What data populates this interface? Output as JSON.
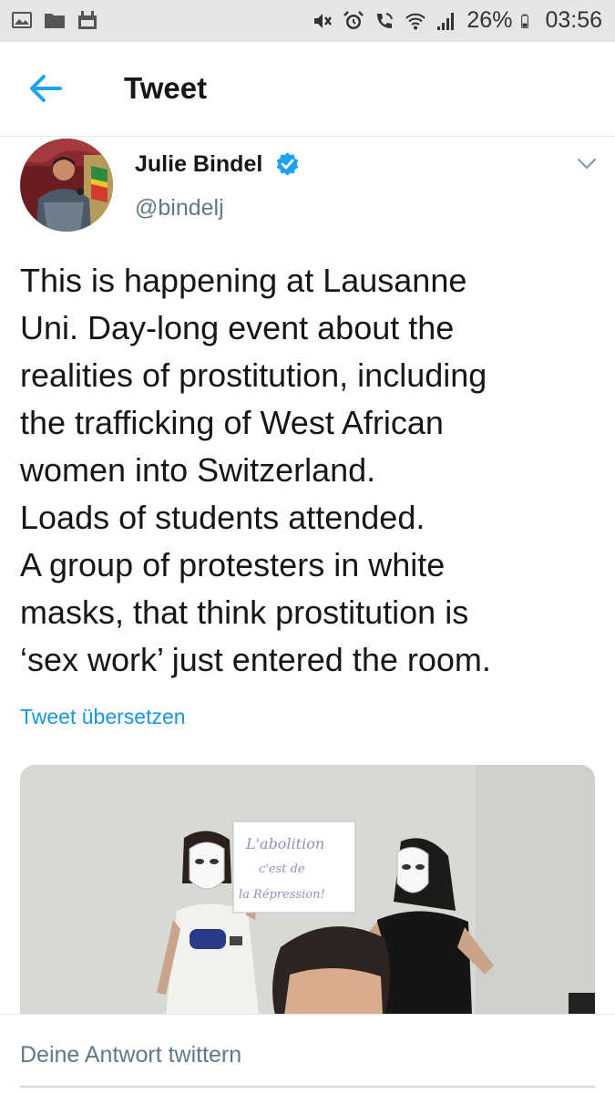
{
  "status_bar": {
    "battery": "26%",
    "time": "03:56",
    "left_icons": [
      "image-icon",
      "folder-icon",
      "calendar-icon"
    ],
    "right_icons": [
      "mute-icon",
      "alarm-icon",
      "wifi-call-icon",
      "wifi-icon",
      "signal-icon",
      "battery-icon"
    ]
  },
  "header": {
    "title": "Tweet",
    "back_icon": "back-arrow-icon"
  },
  "author": {
    "name": "Julie Bindel",
    "handle": "@bindelj",
    "verified": true,
    "menu_icon": "chevron-down-icon"
  },
  "tweet": {
    "lines": [
      "This is happening at Lausanne",
      "Uni. Day-long event about the",
      "realities of prostitution, including",
      "the trafficking of West African",
      "women into Switzerland.",
      "Loads of students attended.",
      "A group of protesters in white",
      "masks, that think prostitution is",
      "‘sex work’ just entered the room."
    ],
    "translate_label": "Tweet übersetzen"
  },
  "media": {
    "sign_lines": [
      "L'abolition",
      "c'est de",
      "la Répression!"
    ]
  },
  "reply": {
    "placeholder": "Deine Antwort twittern"
  },
  "colors": {
    "accent": "#1da1f2",
    "link": "#1b95e0",
    "status_bar_bg": "#e6e6e6",
    "secondary_text": "#657786"
  }
}
